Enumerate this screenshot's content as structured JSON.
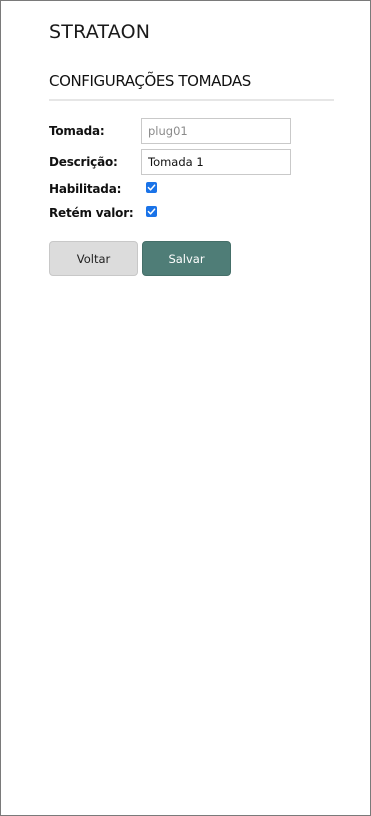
{
  "app": {
    "brand": "STRATAON"
  },
  "page": {
    "title": "CONFIGURAÇÕES TOMADAS"
  },
  "form": {
    "tomada": {
      "label": "Tomada:",
      "value": "plug01",
      "readonly": true
    },
    "descricao": {
      "label": "Descrição:",
      "value": "Tomada 1"
    },
    "habilitada": {
      "label": "Habilitada:",
      "checked": true
    },
    "retem_valor": {
      "label": "Retém valor:",
      "checked": true
    }
  },
  "actions": {
    "back_label": "Voltar",
    "save_label": "Salvar"
  },
  "colors": {
    "accent": "#4f7d77",
    "checkbox": "#1a73e8",
    "secondary_button": "#dcdcdc"
  }
}
